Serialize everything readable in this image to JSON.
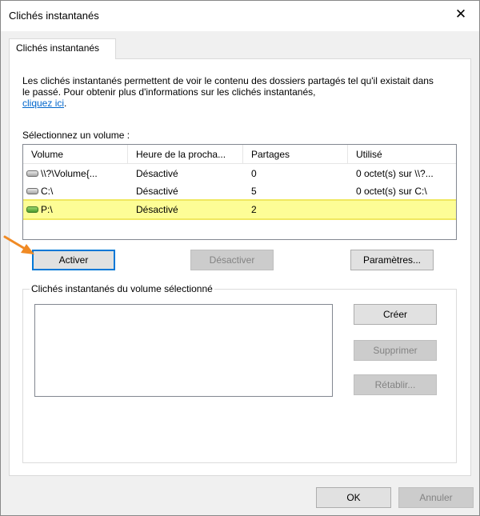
{
  "window": {
    "title": "Clichés instantanés",
    "close_glyph": "✕"
  },
  "tab": {
    "label": "Clichés instantanés"
  },
  "description": {
    "text": "Les clichés instantanés permettent de voir le contenu des dossiers partagés tel qu'il existait dans le passé. Pour obtenir plus d'informations sur les clichés instantanés,",
    "link": "cliquez ici",
    "suffix": "."
  },
  "volumes": {
    "label": "Sélectionnez un volume :",
    "columns": [
      "Volume",
      "Heure de la procha...",
      "Partages",
      "Utilisé"
    ],
    "rows": [
      {
        "icon": "drive-icon",
        "volume": "\\\\?\\Volume{...",
        "next": "Désactivé",
        "shares": "0",
        "used": "0 octet(s) sur \\\\?..."
      },
      {
        "icon": "drive-icon",
        "volume": "C:\\",
        "next": "Désactivé",
        "shares": "5",
        "used": "0 octet(s) sur C:\\"
      },
      {
        "icon": "drive-green-icon",
        "volume": "P:\\",
        "next": "Désactivé",
        "shares": "2",
        "used": "",
        "selected": true
      }
    ]
  },
  "actions": {
    "activate": "Activer",
    "deactivate": "Désactiver",
    "settings": "Paramètres..."
  },
  "snapshots": {
    "group_label": "Clichés instantanés du volume sélectionné",
    "create": "Créer",
    "delete": "Supprimer",
    "restore": "Rétablir..."
  },
  "footer": {
    "ok": "OK",
    "cancel": "Annuler"
  },
  "colors": {
    "highlight": "#fdfd96",
    "arrow": "#f08a24",
    "focus": "#0078d7",
    "link": "#0066cc"
  }
}
